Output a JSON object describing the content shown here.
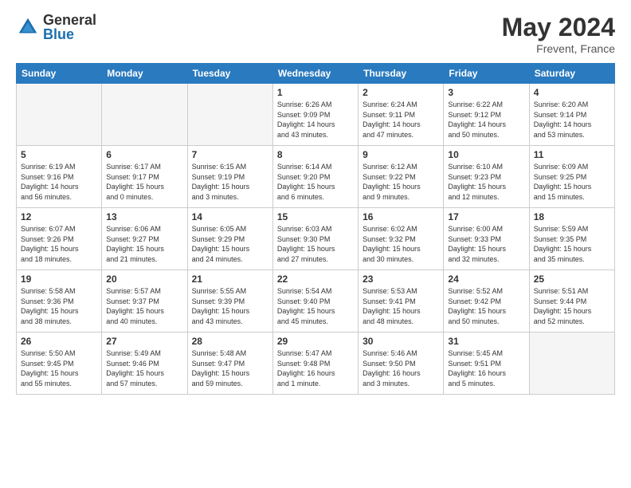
{
  "logo": {
    "general": "General",
    "blue": "Blue"
  },
  "title": {
    "month_year": "May 2024",
    "location": "Frevent, France"
  },
  "headers": [
    "Sunday",
    "Monday",
    "Tuesday",
    "Wednesday",
    "Thursday",
    "Friday",
    "Saturday"
  ],
  "weeks": [
    [
      {
        "day": "",
        "info": ""
      },
      {
        "day": "",
        "info": ""
      },
      {
        "day": "",
        "info": ""
      },
      {
        "day": "1",
        "info": "Sunrise: 6:26 AM\nSunset: 9:09 PM\nDaylight: 14 hours\nand 43 minutes."
      },
      {
        "day": "2",
        "info": "Sunrise: 6:24 AM\nSunset: 9:11 PM\nDaylight: 14 hours\nand 47 minutes."
      },
      {
        "day": "3",
        "info": "Sunrise: 6:22 AM\nSunset: 9:12 PM\nDaylight: 14 hours\nand 50 minutes."
      },
      {
        "day": "4",
        "info": "Sunrise: 6:20 AM\nSunset: 9:14 PM\nDaylight: 14 hours\nand 53 minutes."
      }
    ],
    [
      {
        "day": "5",
        "info": "Sunrise: 6:19 AM\nSunset: 9:16 PM\nDaylight: 14 hours\nand 56 minutes."
      },
      {
        "day": "6",
        "info": "Sunrise: 6:17 AM\nSunset: 9:17 PM\nDaylight: 15 hours\nand 0 minutes."
      },
      {
        "day": "7",
        "info": "Sunrise: 6:15 AM\nSunset: 9:19 PM\nDaylight: 15 hours\nand 3 minutes."
      },
      {
        "day": "8",
        "info": "Sunrise: 6:14 AM\nSunset: 9:20 PM\nDaylight: 15 hours\nand 6 minutes."
      },
      {
        "day": "9",
        "info": "Sunrise: 6:12 AM\nSunset: 9:22 PM\nDaylight: 15 hours\nand 9 minutes."
      },
      {
        "day": "10",
        "info": "Sunrise: 6:10 AM\nSunset: 9:23 PM\nDaylight: 15 hours\nand 12 minutes."
      },
      {
        "day": "11",
        "info": "Sunrise: 6:09 AM\nSunset: 9:25 PM\nDaylight: 15 hours\nand 15 minutes."
      }
    ],
    [
      {
        "day": "12",
        "info": "Sunrise: 6:07 AM\nSunset: 9:26 PM\nDaylight: 15 hours\nand 18 minutes."
      },
      {
        "day": "13",
        "info": "Sunrise: 6:06 AM\nSunset: 9:27 PM\nDaylight: 15 hours\nand 21 minutes."
      },
      {
        "day": "14",
        "info": "Sunrise: 6:05 AM\nSunset: 9:29 PM\nDaylight: 15 hours\nand 24 minutes."
      },
      {
        "day": "15",
        "info": "Sunrise: 6:03 AM\nSunset: 9:30 PM\nDaylight: 15 hours\nand 27 minutes."
      },
      {
        "day": "16",
        "info": "Sunrise: 6:02 AM\nSunset: 9:32 PM\nDaylight: 15 hours\nand 30 minutes."
      },
      {
        "day": "17",
        "info": "Sunrise: 6:00 AM\nSunset: 9:33 PM\nDaylight: 15 hours\nand 32 minutes."
      },
      {
        "day": "18",
        "info": "Sunrise: 5:59 AM\nSunset: 9:35 PM\nDaylight: 15 hours\nand 35 minutes."
      }
    ],
    [
      {
        "day": "19",
        "info": "Sunrise: 5:58 AM\nSunset: 9:36 PM\nDaylight: 15 hours\nand 38 minutes."
      },
      {
        "day": "20",
        "info": "Sunrise: 5:57 AM\nSunset: 9:37 PM\nDaylight: 15 hours\nand 40 minutes."
      },
      {
        "day": "21",
        "info": "Sunrise: 5:55 AM\nSunset: 9:39 PM\nDaylight: 15 hours\nand 43 minutes."
      },
      {
        "day": "22",
        "info": "Sunrise: 5:54 AM\nSunset: 9:40 PM\nDaylight: 15 hours\nand 45 minutes."
      },
      {
        "day": "23",
        "info": "Sunrise: 5:53 AM\nSunset: 9:41 PM\nDaylight: 15 hours\nand 48 minutes."
      },
      {
        "day": "24",
        "info": "Sunrise: 5:52 AM\nSunset: 9:42 PM\nDaylight: 15 hours\nand 50 minutes."
      },
      {
        "day": "25",
        "info": "Sunrise: 5:51 AM\nSunset: 9:44 PM\nDaylight: 15 hours\nand 52 minutes."
      }
    ],
    [
      {
        "day": "26",
        "info": "Sunrise: 5:50 AM\nSunset: 9:45 PM\nDaylight: 15 hours\nand 55 minutes."
      },
      {
        "day": "27",
        "info": "Sunrise: 5:49 AM\nSunset: 9:46 PM\nDaylight: 15 hours\nand 57 minutes."
      },
      {
        "day": "28",
        "info": "Sunrise: 5:48 AM\nSunset: 9:47 PM\nDaylight: 15 hours\nand 59 minutes."
      },
      {
        "day": "29",
        "info": "Sunrise: 5:47 AM\nSunset: 9:48 PM\nDaylight: 16 hours\nand 1 minute."
      },
      {
        "day": "30",
        "info": "Sunrise: 5:46 AM\nSunset: 9:50 PM\nDaylight: 16 hours\nand 3 minutes."
      },
      {
        "day": "31",
        "info": "Sunrise: 5:45 AM\nSunset: 9:51 PM\nDaylight: 16 hours\nand 5 minutes."
      },
      {
        "day": "",
        "info": ""
      }
    ]
  ]
}
